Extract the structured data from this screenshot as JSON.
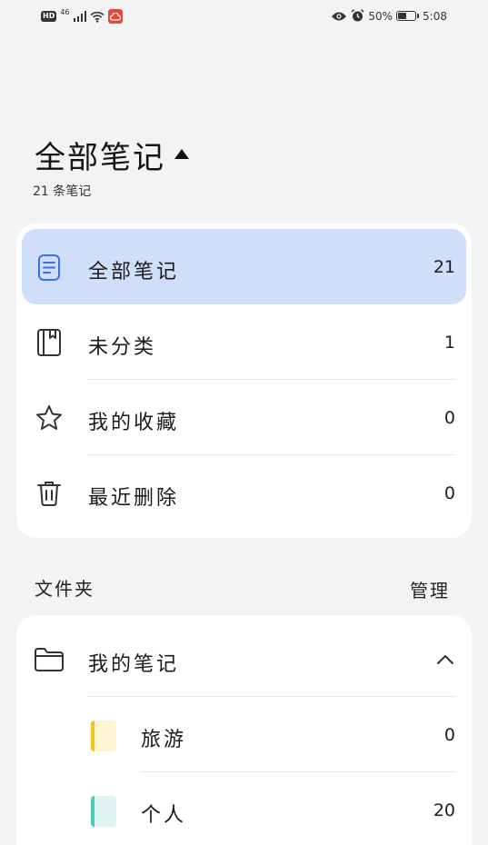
{
  "status_bar": {
    "hd": "HD",
    "network": "46",
    "battery_percent": "50%",
    "time": "5:08",
    "battery_level": 0.5
  },
  "header": {
    "title": "全部笔记",
    "subtitle": "21 条笔记"
  },
  "categories": [
    {
      "label": "全部笔记",
      "count": "21",
      "icon": "note-icon",
      "active": true
    },
    {
      "label": "未分类",
      "count": "1",
      "icon": "notebook-icon",
      "active": false
    },
    {
      "label": "我的收藏",
      "count": "0",
      "icon": "star-icon",
      "active": false
    },
    {
      "label": "最近删除",
      "count": "0",
      "icon": "trash-icon",
      "active": false
    }
  ],
  "folders_section": {
    "label": "文件夹",
    "manage": "管理"
  },
  "folder": {
    "label": "我的笔记",
    "icon": "folder-icon",
    "expanded": true,
    "subfolders": [
      {
        "label": "旅游",
        "count": "0",
        "color": "#f5c518",
        "bg": "#fdf5d2"
      },
      {
        "label": "个人",
        "count": "20",
        "color": "#4cc9b5",
        "bg": "#ddf4f0"
      }
    ]
  },
  "colors": {
    "accent": "#3d6fe0",
    "active_bg": "#cfdffb",
    "background": "#f1f3f5"
  }
}
